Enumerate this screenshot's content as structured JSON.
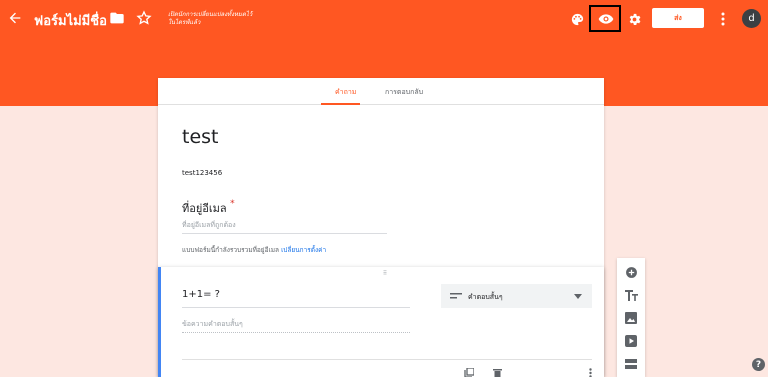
{
  "header": {
    "form_title": "ฟอร์มไม่มีชื่อ",
    "save_notice_line1": "เปิดนักการเปลี่ยนแปลงทั้งหมดไว้",
    "save_notice_line2": "ในไดรฟ์แล้ว",
    "send_label": "ส่ง",
    "avatar_initial": "d",
    "icons": [
      "back-arrow-icon",
      "folder-icon",
      "star-icon",
      "palette-icon",
      "eye-icon",
      "gear-icon",
      "more-vert-icon"
    ]
  },
  "tabs": [
    {
      "label": "คำถาม",
      "active": true
    },
    {
      "label": "การตอบกลับ",
      "active": false
    }
  ],
  "form": {
    "title": "test",
    "description": "test123456",
    "email_label": "ที่อยู่อีเมล",
    "required_mark": "*",
    "email_placeholder": "ที่อยู่อีเมลที่ถูกต้อง",
    "email_note": "แบบฟอร์มนี้กำลังรวบรวมที่อยู่อีเมล",
    "email_link": "เปลี่ยนการตั้งค่า"
  },
  "question": {
    "drag_handle": "⠿",
    "title": "1+1= ?",
    "answer_placeholder": "ข้อความคำตอบสั้นๆ",
    "type_label": "คำตอบสั้นๆ"
  },
  "sidebar_icons": [
    "add-question-icon",
    "add-title-icon",
    "add-image-icon",
    "add-video-icon",
    "add-section-icon"
  ],
  "help_label": "?",
  "colors": {
    "accent": "#ff5722",
    "link": "#1a73e8",
    "focus": "#4285f4",
    "background": "#fde7e1"
  }
}
